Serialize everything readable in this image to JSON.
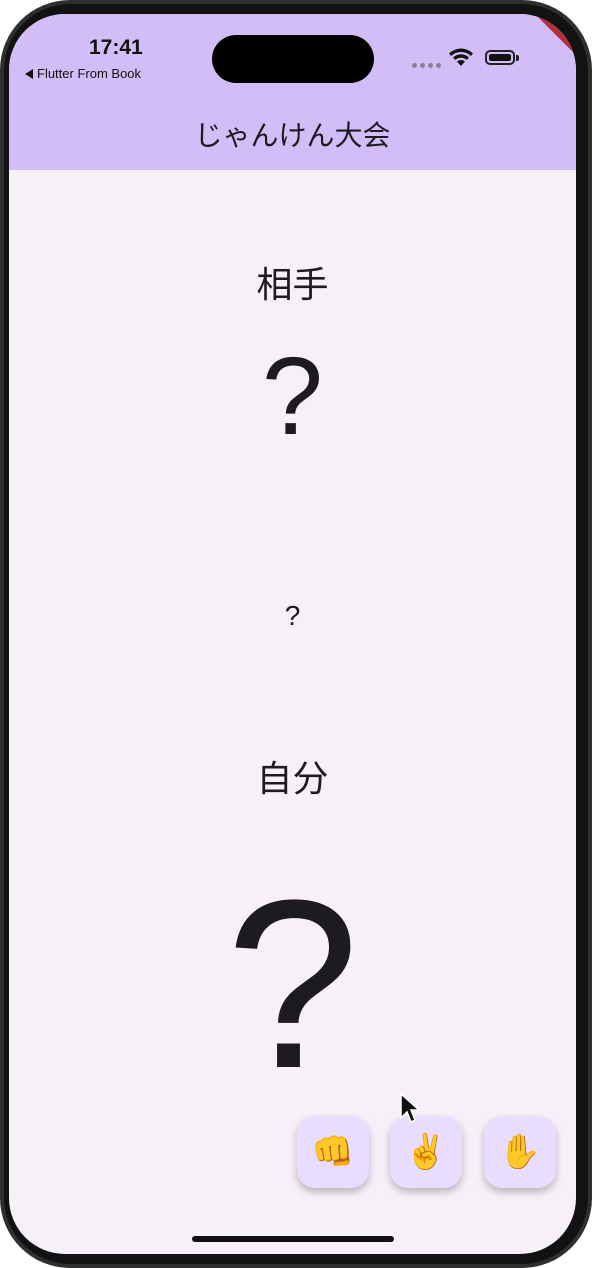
{
  "status_bar": {
    "time": "17:41",
    "back_label": "Flutter From Book"
  },
  "debug_banner": "DEBUG",
  "app_bar": {
    "title": "じゃんけん大会",
    "color": "#d3bdf7"
  },
  "opponent": {
    "label": "相手",
    "hand": "?"
  },
  "result": {
    "text": "?"
  },
  "self": {
    "label": "自分",
    "hand": "?"
  },
  "buttons": [
    {
      "name": "rock",
      "emoji": "👊"
    },
    {
      "name": "scissors",
      "emoji": "✌️"
    },
    {
      "name": "paper",
      "emoji": "✋"
    }
  ],
  "colors": {
    "background": "#f6f0f8",
    "fab": "#e9ddff"
  }
}
